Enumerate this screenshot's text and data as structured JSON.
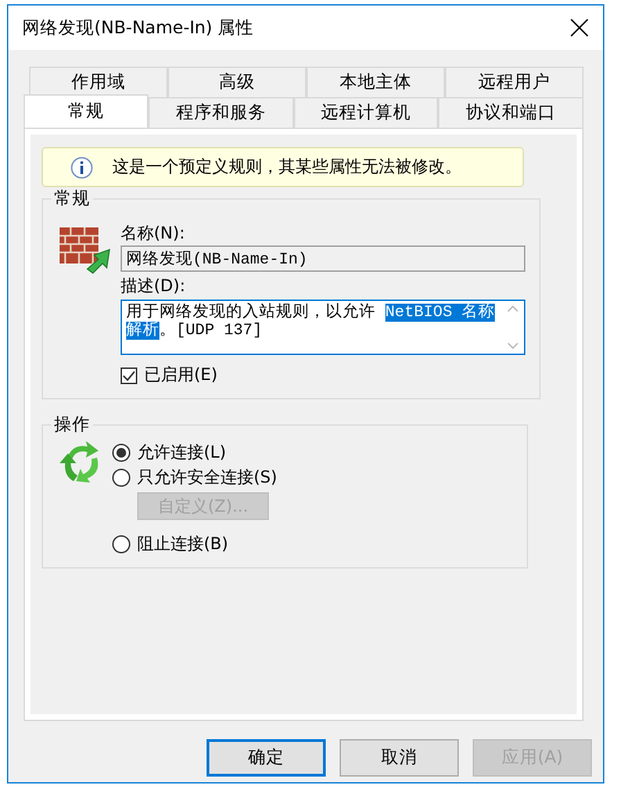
{
  "window": {
    "title": "网络发现(NB-Name-In) 属性"
  },
  "tab_rows": [
    {
      "tabs": [
        {
          "label": "作用域",
          "selected": false
        },
        {
          "label": "高级",
          "selected": false
        },
        {
          "label": "本地主体",
          "selected": false
        },
        {
          "label": "远程用户",
          "selected": false
        }
      ]
    },
    {
      "tabs": [
        {
          "label": "常规",
          "selected": true
        },
        {
          "label": "程序和服务",
          "selected": false
        },
        {
          "label": "远程计算机",
          "selected": false
        },
        {
          "label": "协议和端口",
          "selected": false
        }
      ]
    }
  ],
  "info_banner": {
    "text": "这是一个预定义规则，其某些属性无法被修改。"
  },
  "general_group": {
    "title": "常规",
    "name_label": "名称(N):",
    "name_value": "网络发现(NB-Name-In)",
    "description_label": "描述(D):",
    "description": {
      "before": "用于网络发现的入站规则，以允许 ",
      "selected": "NetBIOS 名称解析",
      "after": "。[UDP 137]"
    },
    "enabled": {
      "label": "已启用(E)",
      "checked": true
    }
  },
  "action_group": {
    "title": "操作",
    "options": [
      {
        "kind": "radio",
        "label": "允许连接(L)",
        "selected": true
      },
      {
        "kind": "radio",
        "label": "只允许安全连接(S)",
        "selected": false
      },
      {
        "kind": "button",
        "label": "自定义(Z)...",
        "disabled": true
      },
      {
        "kind": "radio",
        "label": "阻止连接(B)",
        "selected": false
      }
    ]
  },
  "buttons": [
    {
      "label": "确定",
      "default": true,
      "disabled": false
    },
    {
      "label": "取消",
      "default": false,
      "disabled": false
    },
    {
      "label": "应用(A)",
      "default": false,
      "disabled": true
    }
  ]
}
